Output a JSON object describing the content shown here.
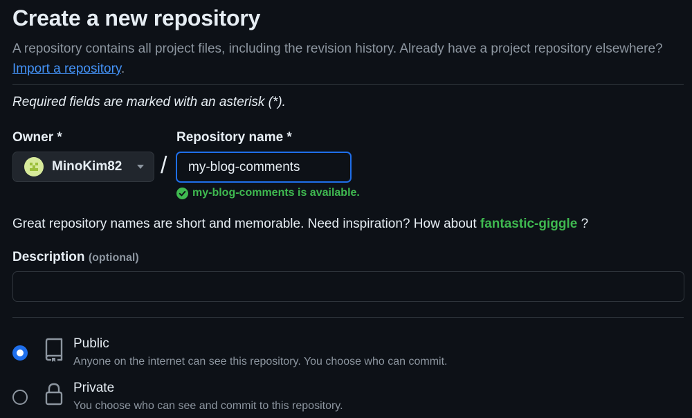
{
  "heading": "Create a new repository",
  "intro": {
    "text": "A repository contains all project files, including the revision history. Already have a project repository elsewhere?",
    "link": "Import a repository",
    "tail": "."
  },
  "required_note": "Required fields are marked with an asterisk (*).",
  "owner": {
    "label": "Owner *",
    "value": "MinoKim82",
    "avatar_color": "#d7ea9b"
  },
  "slash": "/",
  "repo": {
    "label": "Repository name *",
    "value": "my-blog-comments",
    "availability": "my-blog-comments is available.",
    "status_color": "#3fb950"
  },
  "suggestion": {
    "text": "Great repository names are short and memorable. Need inspiration? How about",
    "name": "fantastic-giggle",
    "tail": "?"
  },
  "description": {
    "label": "Description",
    "optional": "(optional)",
    "value": ""
  },
  "visibility": [
    {
      "title": "Public",
      "desc": "Anyone on the internet can see this repository. You choose who can commit.",
      "icon": "repo-icon",
      "selected": true
    },
    {
      "title": "Private",
      "desc": "You choose who can see and commit to this repository.",
      "icon": "lock-icon",
      "selected": false
    }
  ],
  "colors": {
    "background": "#0d1117",
    "accent": "#1f6feb",
    "link": "#4493f8",
    "success": "#3fb950"
  }
}
